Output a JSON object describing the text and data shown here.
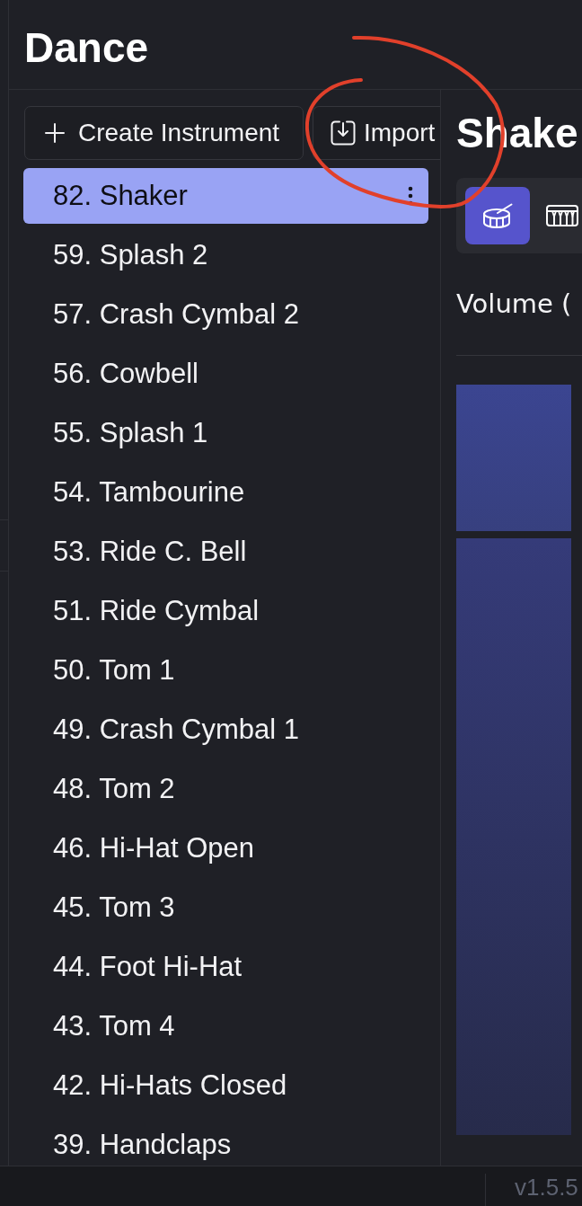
{
  "project": {
    "title": "Dance"
  },
  "sidebar": {
    "buttons": [
      {
        "kind": "create",
        "label": "Create Instrument"
      },
      {
        "kind": "import",
        "label": "Import"
      }
    ],
    "instruments": [
      {
        "label": "82. Shaker",
        "selected": true
      },
      {
        "label": "59. Splash 2",
        "selected": false
      },
      {
        "label": "57. Crash Cymbal 2",
        "selected": false
      },
      {
        "label": "56. Cowbell",
        "selected": false
      },
      {
        "label": "55. Splash 1",
        "selected": false
      },
      {
        "label": "54. Tambourine",
        "selected": false
      },
      {
        "label": "53. Ride C. Bell",
        "selected": false
      },
      {
        "label": "51. Ride Cymbal",
        "selected": false
      },
      {
        "label": "50. Tom 1",
        "selected": false
      },
      {
        "label": "49. Crash Cymbal 1",
        "selected": false
      },
      {
        "label": "48. Tom 2",
        "selected": false
      },
      {
        "label": "46. Hi-Hat Open",
        "selected": false
      },
      {
        "label": "45. Tom 3",
        "selected": false
      },
      {
        "label": "44. Foot Hi-Hat",
        "selected": false
      },
      {
        "label": "43. Tom 4",
        "selected": false
      },
      {
        "label": "42. Hi-Hats Closed",
        "selected": false
      },
      {
        "label": "39. Handclaps",
        "selected": false
      }
    ]
  },
  "detail": {
    "title": "Shake",
    "instrument_types": [
      {
        "kind": "drum",
        "selected": true
      },
      {
        "kind": "keyboard",
        "selected": false
      }
    ],
    "volume_label": "Volume ("
  },
  "status_bar": {
    "version": "v1.5.5"
  },
  "annotations": [
    {
      "kind": "freehand-circle"
    }
  ]
}
